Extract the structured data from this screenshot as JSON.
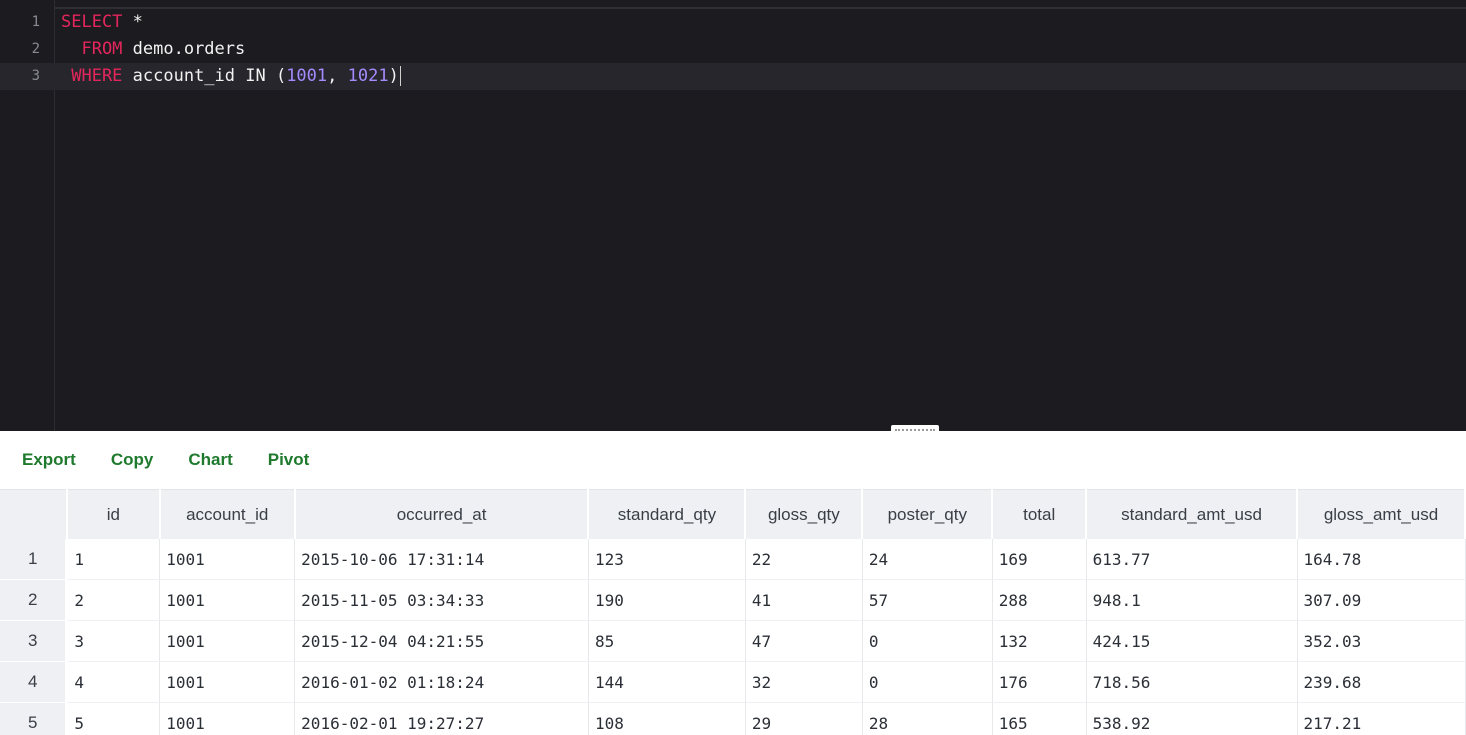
{
  "editor": {
    "lines": [
      {
        "number": "1",
        "tokens": [
          {
            "t": "SELECT",
            "c": "kw"
          },
          {
            "t": " *",
            "c": ""
          }
        ]
      },
      {
        "number": "2",
        "tokens": [
          {
            "t": "  FROM",
            "c": "kw"
          },
          {
            "t": " demo.orders",
            "c": ""
          }
        ]
      },
      {
        "number": "3",
        "tokens": [
          {
            "t": " WHERE",
            "c": "kw"
          },
          {
            "t": " account_id IN (",
            "c": ""
          },
          {
            "t": "1001",
            "c": "num"
          },
          {
            "t": ", ",
            "c": ""
          },
          {
            "t": "1021",
            "c": "num"
          },
          {
            "t": ")",
            "c": ""
          }
        ]
      }
    ],
    "active_line": 3,
    "colors": {
      "keyword": "#e5265c",
      "number": "#a58bff",
      "background": "#1b1b20"
    }
  },
  "toolbar": {
    "export_label": "Export",
    "copy_label": "Copy",
    "chart_label": "Chart",
    "pivot_label": "Pivot",
    "accent": "#1f7a2e"
  },
  "results": {
    "columns": [
      "id",
      "account_id",
      "occurred_at",
      "standard_qty",
      "gloss_qty",
      "poster_qty",
      "total",
      "standard_amt_usd",
      "gloss_amt_usd"
    ],
    "rows": [
      {
        "n": "1",
        "cells": [
          "1",
          "1001",
          "2015-10-06 17:31:14",
          "123",
          "22",
          "24",
          "169",
          "613.77",
          "164.78"
        ]
      },
      {
        "n": "2",
        "cells": [
          "2",
          "1001",
          "2015-11-05 03:34:33",
          "190",
          "41",
          "57",
          "288",
          "948.1",
          "307.09"
        ]
      },
      {
        "n": "3",
        "cells": [
          "3",
          "1001",
          "2015-12-04 04:21:55",
          "85",
          "47",
          "0",
          "132",
          "424.15",
          "352.03"
        ]
      },
      {
        "n": "4",
        "cells": [
          "4",
          "1001",
          "2016-01-02 01:18:24",
          "144",
          "32",
          "0",
          "176",
          "718.56",
          "239.68"
        ]
      },
      {
        "n": "5",
        "cells": [
          "5",
          "1001",
          "2016-02-01 19:27:27",
          "108",
          "29",
          "28",
          "165",
          "538.92",
          "217.21"
        ]
      }
    ]
  }
}
